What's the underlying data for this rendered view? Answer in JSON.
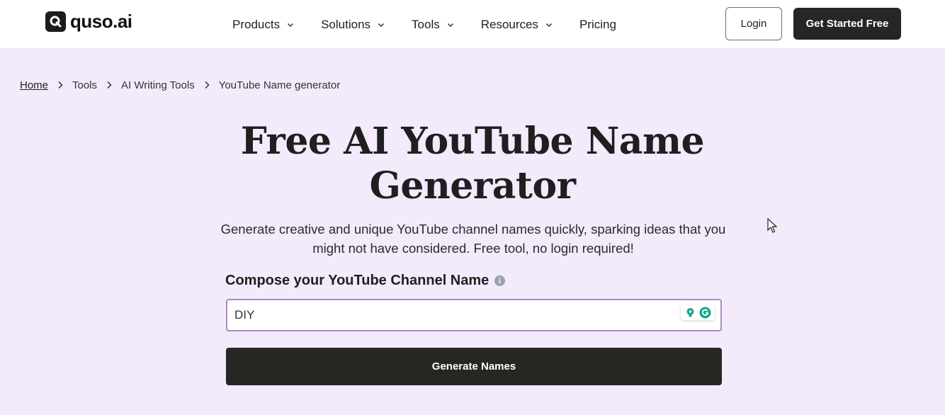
{
  "header": {
    "logo_text": "quso.ai",
    "nav": [
      {
        "label": "Products"
      },
      {
        "label": "Solutions"
      },
      {
        "label": "Tools"
      },
      {
        "label": "Resources"
      },
      {
        "label": "Pricing"
      }
    ],
    "login_label": "Login",
    "cta_label": "Get Started Free"
  },
  "breadcrumb": {
    "items": [
      "Home",
      "Tools",
      "AI Writing Tools",
      "YouTube Name generator"
    ]
  },
  "hero": {
    "title_line1": "Free AI YouTube Name",
    "title_line2": "Generator",
    "subtitle_line1": "Generate creative and unique YouTube channel names quickly, sparking ideas that you",
    "subtitle_line2": "might not have considered. Free tool, no login required!"
  },
  "form": {
    "label": "Compose your YouTube Channel Name",
    "input_value": "DIY",
    "submit_label": "Generate Names"
  },
  "colors": {
    "page_bg": "#f3eafb",
    "button_dark": "#262622",
    "input_border": "#a98bc3"
  }
}
